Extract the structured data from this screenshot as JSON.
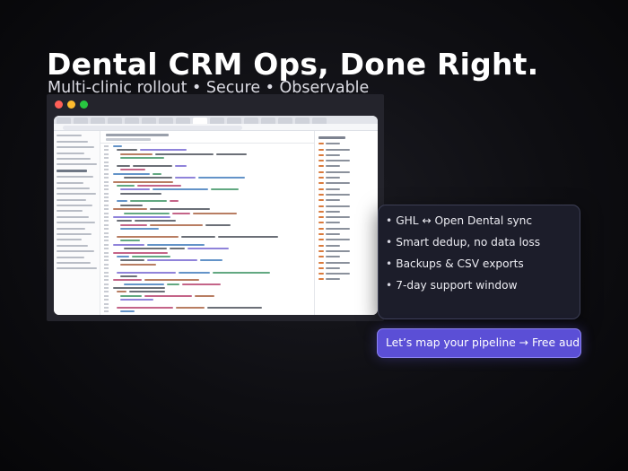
{
  "hero": {
    "headline": "Dental CRM Ops, Done Right.",
    "subhead": "Multi-clinic rollout • Secure • Observable"
  },
  "window_controls": {
    "close_color": "#ff5f57",
    "minimize_color": "#febc2e",
    "maximize_color": "#28c840"
  },
  "features": {
    "items": [
      "GHL ↔ Open Dental sync",
      "Smart dedup, no data loss",
      "Backups & CSV exports",
      "7-day support window"
    ]
  },
  "cta": {
    "label": "Let’s map your pipeline → Free aud"
  },
  "colors": {
    "accent": "#5b4fd6",
    "card_bg": "#1c1d2a"
  }
}
